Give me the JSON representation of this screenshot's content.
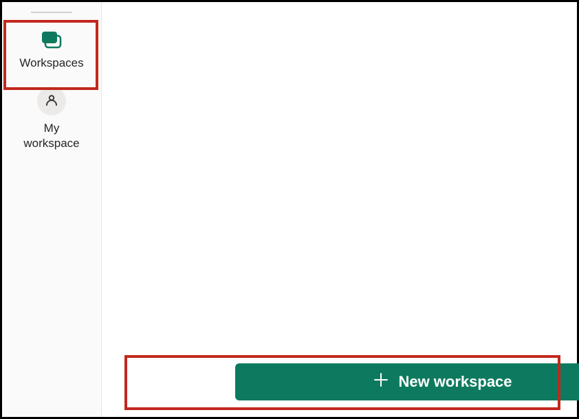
{
  "sidebar": {
    "items": [
      {
        "label": "Workspaces",
        "icon": "workspaces-icon"
      },
      {
        "label": "My\nworkspace",
        "icon": "person-icon"
      }
    ]
  },
  "main": {
    "new_workspace_label": "New workspace"
  },
  "colors": {
    "accent": "#0d7a5f",
    "highlight": "#c2281d"
  }
}
